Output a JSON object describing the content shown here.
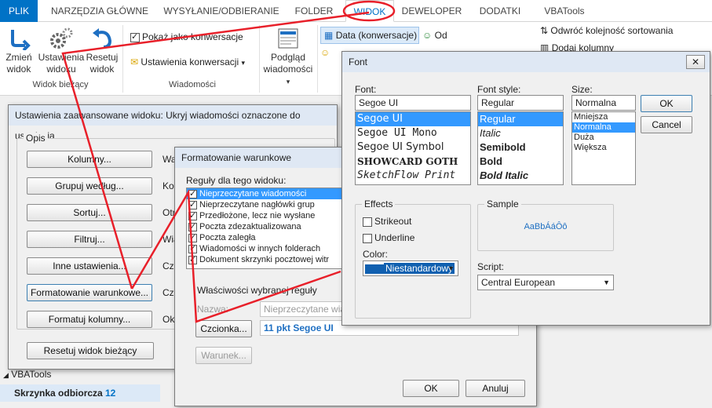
{
  "ribbon_tabs": [
    "PLIK",
    "NARZĘDZIA GŁÓWNE",
    "WYSYŁANIE/ODBIERANIE",
    "FOLDER",
    "WIDOK",
    "DEWELOPER",
    "DODATKI",
    "VBATools"
  ],
  "ribbon": {
    "change_view_line1": "Zmień",
    "change_view_line2": "widok",
    "view_settings_line1": "Ustawienia",
    "view_settings_line2": "widoku",
    "reset_view_line1": "Resetuj",
    "reset_view_line2": "widok",
    "group_current_view": "Widok bieżący",
    "show_as_conversations": "Pokaż jako konwersacje",
    "conversation_settings": "Ustawienia konwersacji",
    "group_messages": "Wiadomości",
    "preview_line1": "Podgląd",
    "preview_line2": "wiadomości",
    "arrange_date": "Data (konwersacje)",
    "arrange_from": "Od",
    "reverse_sort": "Odwróć kolejność sortowania",
    "add_columns": "Dodaj kolumny"
  },
  "adv_dialog": {
    "title": "Ustawienia zaawansowane widoku: Ukryj wiadomości oznaczone do usunięcia",
    "legend": "Opis",
    "buttons": [
      "Kolumny...",
      "Grupuj według...",
      "Sortuj...",
      "Filtruj...",
      "Inne ustawienia...",
      "Formatowanie warunkowe...",
      "Formatuj kolumny..."
    ],
    "side_labels": [
      "Wa",
      "Kon",
      "Otr",
      "Wia",
      "Czc",
      "Czc",
      "Okr"
    ],
    "reset_button": "Resetuj widok bieżący"
  },
  "cond_dialog": {
    "title": "Formatowanie warunkowe",
    "rules_label": "Reguły dla tego widoku:",
    "rules": [
      {
        "label": "Nieprzeczytane wiadomości",
        "checked": true,
        "selected": true
      },
      {
        "label": "Nieprzeczytane nagłówki grup",
        "checked": true,
        "selected": false
      },
      {
        "label": "Przedłożone, lecz nie wysłane",
        "checked": true,
        "selected": false
      },
      {
        "label": "Poczta zdezaktualizowana",
        "checked": true,
        "selected": false
      },
      {
        "label": "Poczta zaległa",
        "checked": true,
        "selected": false
      },
      {
        "label": "Wiadomości w innych folderach",
        "checked": true,
        "selected": false
      },
      {
        "label": "Dokument skrzynki pocztowej witr",
        "checked": true,
        "selected": false
      }
    ],
    "props_label": "Właściwości wybranej reguły",
    "name_label": "Nazwa:",
    "name_value": "Nieprzeczytane wiad",
    "font_button": "Czcionka...",
    "font_value": "11 pkt Segoe UI",
    "condition_button": "Warunek...",
    "ok": "OK",
    "cancel": "Anuluj"
  },
  "font_dialog": {
    "title": "Font",
    "font_label": "Font:",
    "font_value": "Segoe UI",
    "fonts": [
      "Segoe UI",
      "Segoe UI Mono",
      "Segoe UI Symbol",
      "SHOWCARD GOTH",
      "SketchFlow Print"
    ],
    "style_label": "Font style:",
    "style_value": "Regular",
    "styles": [
      "Regular",
      "Italic",
      "Semibold",
      "Bold",
      "Bold Italic"
    ],
    "size_label": "Size:",
    "size_value": "Normalna",
    "sizes": [
      "Mniejsza",
      "Normalna",
      "Duża",
      "Większa"
    ],
    "ok": "OK",
    "cancel": "Cancel",
    "effects_legend": "Effects",
    "strikeout": "Strikeout",
    "underline": "Underline",
    "color_label": "Color:",
    "color_value": "Niestandardowy",
    "sample_legend": "Sample",
    "sample_text": "AaBbÁáÔô",
    "script_label": "Script:",
    "script_value": "Central European"
  },
  "bottom": {
    "vbatools": "VBATools",
    "inbox": "Skrzynka odbiorcza",
    "inbox_count": "12"
  },
  "colors": {
    "accent": "#0072c6",
    "annotation": "#e8202a",
    "selection": "#3399ff",
    "custom_color": "#1060b0"
  }
}
